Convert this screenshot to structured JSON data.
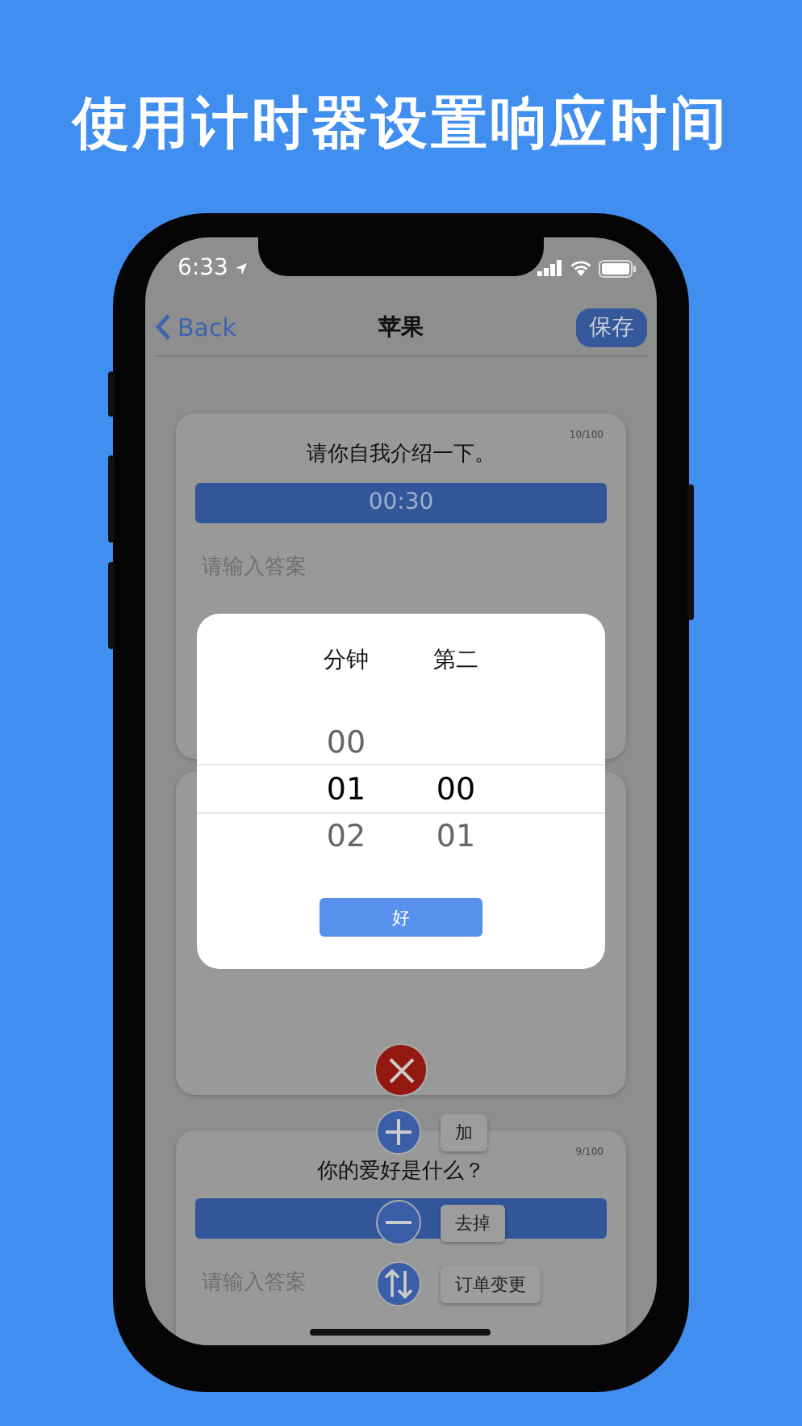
{
  "headline": "使用计时器设置响应时间",
  "status_bar": {
    "time": "6:33"
  },
  "nav": {
    "back": "Back",
    "title": "苹果",
    "save": "保存"
  },
  "cards": [
    {
      "counter": "10/100",
      "question": "请你自我介绍一下。",
      "timer": "00:30",
      "placeholder": "请输入答案"
    },
    {
      "counter": "9/100",
      "question": "你的爱好是什么？",
      "placeholder": "请输入答案"
    }
  ],
  "picker": {
    "columns": [
      {
        "label": "分钟",
        "items": [
          {
            "text": "00",
            "selected": false
          },
          {
            "text": "01",
            "selected": true
          },
          {
            "text": "02",
            "selected": false
          }
        ]
      },
      {
        "label": "第二",
        "items": [
          {
            "text": "00",
            "selected": true
          },
          {
            "text": "01",
            "selected": false
          }
        ]
      }
    ],
    "ok": "好"
  },
  "fab_menu": [
    {
      "kind": "add",
      "label": "加"
    },
    {
      "kind": "remove",
      "label": "去掉"
    },
    {
      "kind": "reorder",
      "label": "订单变更"
    }
  ]
}
